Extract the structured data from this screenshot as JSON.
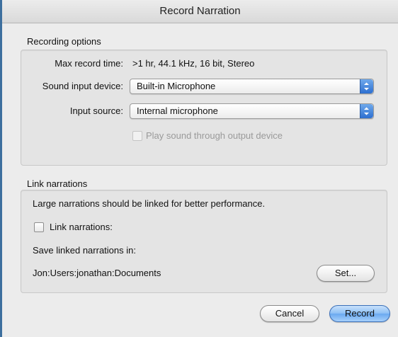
{
  "window": {
    "title": "Record Narration"
  },
  "recording_options": {
    "group_title": "Recording options",
    "max_record_time_label": "Max record time:",
    "max_record_time_value": ">1 hr, 44.1 kHz, 16 bit, Stereo",
    "sound_input_device_label": "Sound input device:",
    "sound_input_device_value": "Built-in Microphone",
    "input_source_label": "Input source:",
    "input_source_value": "Internal microphone",
    "play_through_label": "Play sound through output device",
    "play_through_checked": false,
    "play_through_enabled": false
  },
  "link_narrations": {
    "group_title": "Link narrations",
    "info_text": "Large narrations should be linked for better performance.",
    "checkbox_label": "Link narrations:",
    "checkbox_checked": false,
    "save_in_label": "Save linked narrations in:",
    "save_path": "Jon:Users:jonathan:Documents",
    "set_button_label": "Set..."
  },
  "buttons": {
    "cancel_label": "Cancel",
    "record_label": "Record"
  },
  "colors": {
    "accent": "#6aa9f0",
    "window_background": "#ececec",
    "group_background": "#e4e4e4"
  }
}
